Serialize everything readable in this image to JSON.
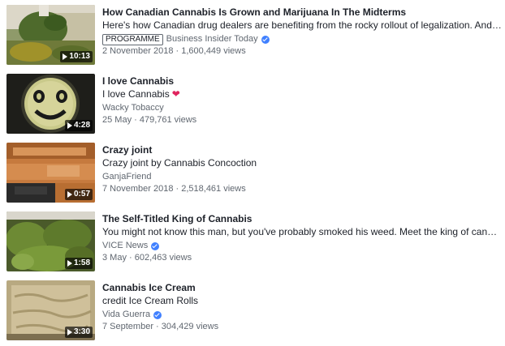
{
  "videos": [
    {
      "title": "How Canadian Cannabis Is Grown and Marijuana In The Midterms",
      "description": "Here's how Canadian drug dealers are benefiting from the rocky rollout of legalization. And what to...",
      "badge": "PROGRAMME",
      "channel": "Business Insider Today",
      "verified": true,
      "date": "2 November 2018",
      "views": "1,600,449 views",
      "duration": "10:13"
    },
    {
      "title": "I love Cannabis",
      "description": "I love Cannabis",
      "channel": "Wacky Tobaccy",
      "date": "25 May",
      "views": "479,761 views",
      "duration": "4:28",
      "heart_icon": "red-heart-icon",
      "heart_color": "#e0245e"
    },
    {
      "title": "Crazy joint",
      "description": "Crazy joint by Cannabis Concoction",
      "channel": "GanjaFriend",
      "date": "7 November 2018",
      "views": "2,518,461 views",
      "duration": "0:57"
    },
    {
      "title": "The Self-Titled King of Cannabis",
      "description": "You might not know this man, but you've probably smoked his weed. Meet the king of cannabis:...",
      "channel": "VICE News",
      "verified": true,
      "date": "3 May",
      "views": "602,463 views",
      "duration": "1:58"
    },
    {
      "title": "Cannabis Ice Cream",
      "description": "credit Ice Cream Rolls",
      "channel": "Vida Guerra",
      "verified": true,
      "date": "7 September",
      "views": "304,429 views",
      "duration": "3:30"
    }
  ],
  "separator": " · ",
  "colors": {
    "verified": "#4080ff",
    "secondary_text": "#606770",
    "primary_text": "#1d2129"
  }
}
